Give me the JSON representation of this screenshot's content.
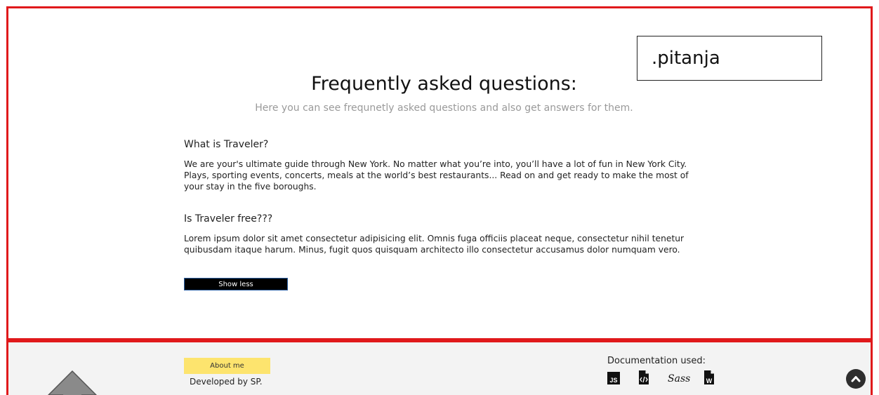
{
  "annotation": {
    "label": ".pitanja"
  },
  "faq": {
    "title": "Frequently asked questions:",
    "subtitle": "Here you can see frequnetly asked questions and also get answers for them.",
    "items": [
      {
        "question": "What is Traveler?",
        "answer": "We are your's ultimate guide through New York. No matter what you’re into, you’ll have a lot of fun in New York City. Plays, sporting events, concerts, meals at the world’s best restaurants... Read on and get ready to make the most of your stay in the five boroughs."
      },
      {
        "question": "Is Traveler free???",
        "answer": "Lorem ipsum dolor sit amet consectetur adipisicing elit. Omnis fuga officiis placeat neque, consectetur nihil tenetur quibusdam itaque harum. Minus, fugit quos quisquam architecto illo consectetur accusamus dolor numquam vero."
      }
    ],
    "toggle_label": "Show less"
  },
  "footer": {
    "about_label": "About me",
    "developed_by": "Developed by SP.",
    "documentation_title": "Documentation used:",
    "doc_icons": [
      "js-icon",
      "html-file-icon",
      "sass-icon",
      "word-file-icon"
    ],
    "doc_icon_texts": {
      "js": "JS",
      "sass": "Sass",
      "word": "W"
    }
  },
  "colors": {
    "outline": "#e0191b",
    "about_button": "#fde46e",
    "footer_bg": "#f3f3f3",
    "toggle_button": "#000000"
  }
}
